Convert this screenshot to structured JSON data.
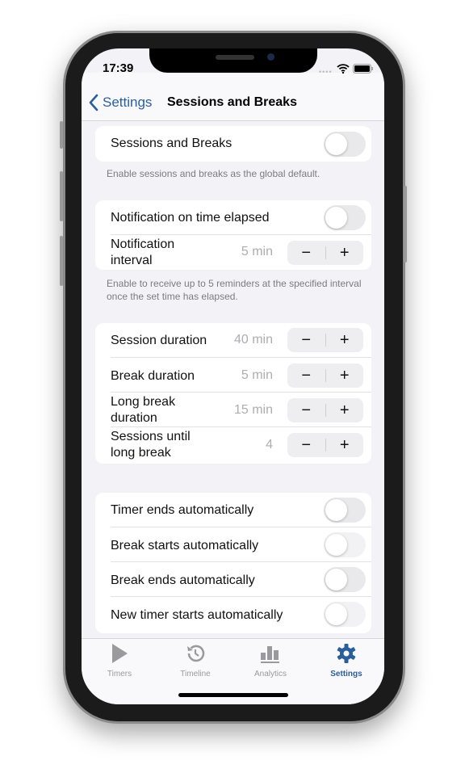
{
  "status": {
    "time": "17:39"
  },
  "nav": {
    "back_label": "Settings",
    "title": "Sessions and Breaks"
  },
  "section1": {
    "rows": [
      {
        "label": "Sessions and Breaks",
        "toggle": false
      }
    ],
    "footer": "Enable sessions and breaks as the global default."
  },
  "section2": {
    "rows": [
      {
        "label": "Notification on time elapsed",
        "toggle": false
      },
      {
        "label": "Notification interval",
        "value": "5 min"
      }
    ],
    "footer": "Enable to receive up to 5 reminders at the specified interval once the set time has elapsed."
  },
  "section3": {
    "rows": [
      {
        "label": "Session duration",
        "value": "40 min"
      },
      {
        "label": "Break duration",
        "value": "5 min"
      },
      {
        "label": "Long break duration",
        "value": "15 min"
      },
      {
        "label": "Sessions until long break",
        "value": "4"
      }
    ]
  },
  "section4": {
    "rows": [
      {
        "label": "Timer ends automatically",
        "toggle": false
      },
      {
        "label": "Break starts automatically",
        "toggle": false,
        "disabled": true
      },
      {
        "label": "Break ends automatically",
        "toggle": false
      },
      {
        "label": "New timer starts automatically",
        "toggle": false,
        "disabled": true
      }
    ]
  },
  "stepper": {
    "minus": "−",
    "plus": "+"
  },
  "tabs": [
    {
      "label": "Timers",
      "icon": "play-icon"
    },
    {
      "label": "Timeline",
      "icon": "history-icon"
    },
    {
      "label": "Analytics",
      "icon": "bar-chart-icon"
    },
    {
      "label": "Settings",
      "icon": "gear-icon",
      "active": true
    }
  ],
  "colors": {
    "accent": "#2b5f9a",
    "background": "#f2f2f7"
  }
}
